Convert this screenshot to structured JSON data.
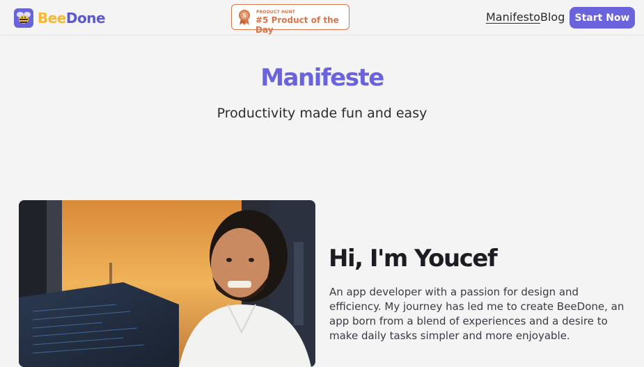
{
  "brand": {
    "name_part1": "Bee",
    "name_part2": "Done",
    "icon": "bee-icon"
  },
  "badge": {
    "small": "PRODUCT HUNT",
    "big": "#5 Product of the Day",
    "medal_number": "5",
    "icon": "medal-icon"
  },
  "nav": {
    "manifesto": "Manifesto",
    "blog": "Blog",
    "cta": "Start Now"
  },
  "hero": {
    "title": "Manifeste",
    "subtitle": "Productivity made fun and easy"
  },
  "about": {
    "title": "Hi, I'm Youcef",
    "text": "An app developer with a passion for design and efficiency. My journey has led me to create BeeDone, an app born from a blend of experiences and a desire to make daily tasks simpler and more enjoyable."
  },
  "colors": {
    "accent": "#6a63dc",
    "badge": "#d9734a",
    "bee_yellow": "#f3b93a"
  }
}
